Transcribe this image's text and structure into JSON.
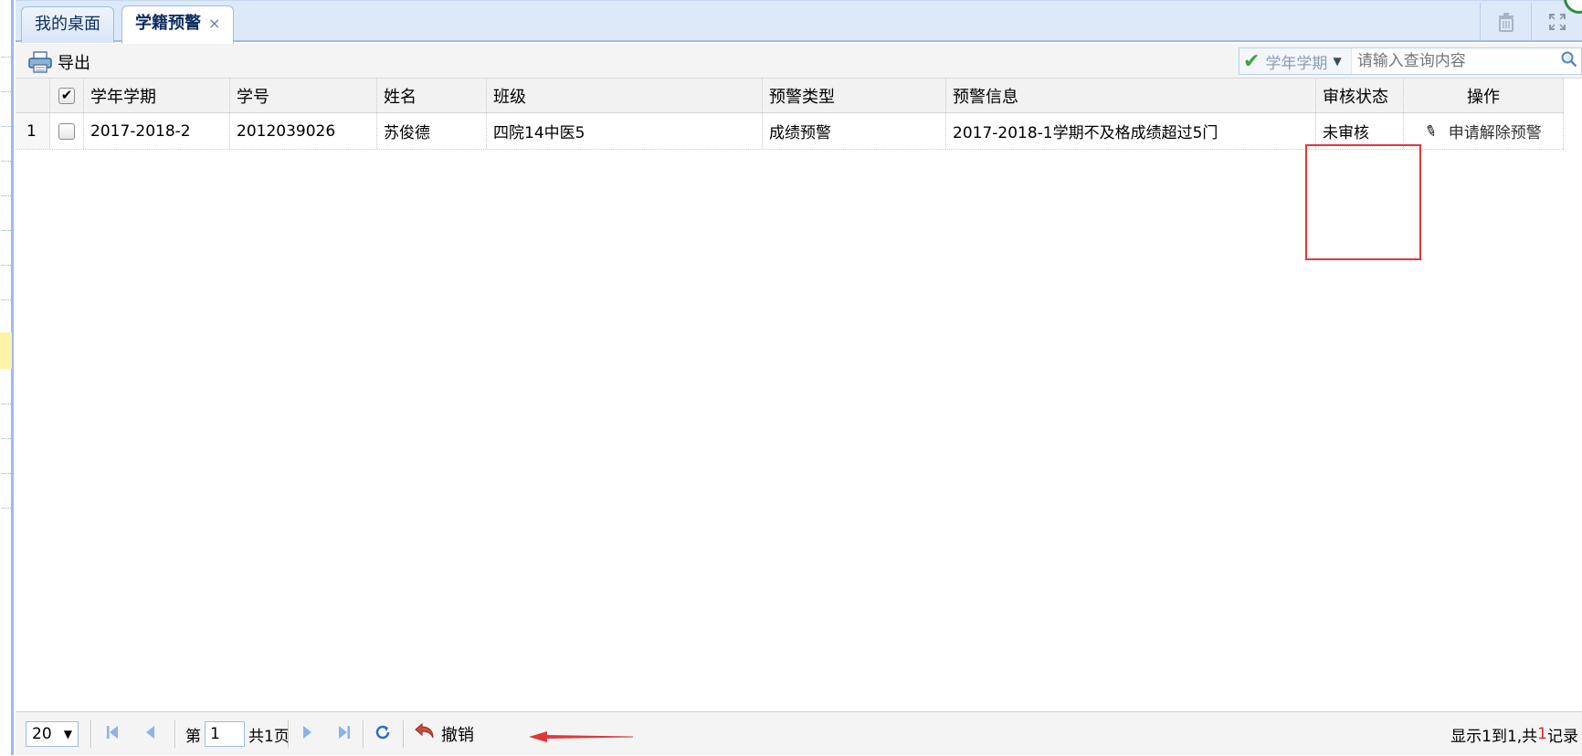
{
  "tabs": [
    {
      "label": "我的桌面",
      "active": false,
      "closable": false
    },
    {
      "label": "学籍预警",
      "active": true,
      "closable": true
    }
  ],
  "tab_close_glyph": "×",
  "tab_tools": [
    "trash-icon",
    "fullscreen-icon"
  ],
  "toolbar": {
    "export_label": "导出",
    "search": {
      "field": "学年学期",
      "placeholder": "请输入查询内容"
    }
  },
  "grid": {
    "columns": [
      "学年学期",
      "学号",
      "姓名",
      "班级",
      "预警类型",
      "预警信息",
      "审核状态",
      "操作"
    ],
    "rows": [
      {
        "row_number": "1",
        "checked": false,
        "term": "2017-2018-2",
        "student_id": "2012039026",
        "name": "苏俊德",
        "class": "四院14中医5",
        "warning_type": "成绩预警",
        "warning_info": "2017-2018-1学期不及格成绩超过5门",
        "review_status": "未审核",
        "action": "申请解除预警"
      }
    ]
  },
  "pager": {
    "page_size": "20",
    "page_prefix": "第",
    "current_page": "1",
    "total_pages_text": "共1页",
    "undo_label": "撤销",
    "info_prefix": "显示1到1,共",
    "info_count": "1",
    "info_suffix": "记录"
  },
  "colors": {
    "accent_border": "#9cbce6",
    "highlight_red": "#e0383a"
  }
}
